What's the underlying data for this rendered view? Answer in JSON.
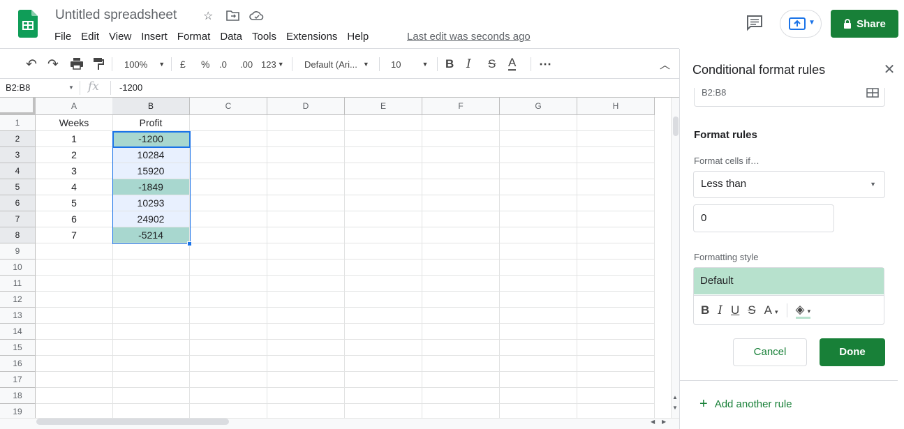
{
  "header": {
    "title": "Untitled spreadsheet",
    "last_edit": "Last edit was seconds ago",
    "share_label": "Share",
    "menu": [
      "File",
      "Edit",
      "View",
      "Insert",
      "Format",
      "Data",
      "Tools",
      "Extensions",
      "Help"
    ]
  },
  "toolbar": {
    "zoom": "100%",
    "currency": "£",
    "percent": "%",
    "dec_decrease": ".0",
    "dec_increase": ".00",
    "more_formats": "123",
    "font": "Default (Ari...",
    "font_size": "10",
    "bold": "B",
    "italic": "I",
    "strike": "S",
    "text_color": "A",
    "more": "⋯"
  },
  "formula_bar": {
    "namebox": "B2:B8",
    "fx": "fx",
    "value": "-1200"
  },
  "sheet": {
    "columns": [
      "A",
      "B",
      "C",
      "D",
      "E",
      "F",
      "G",
      "H"
    ],
    "rows": [
      "1",
      "2",
      "3",
      "4",
      "5",
      "6",
      "7",
      "8",
      "9",
      "10",
      "11",
      "12",
      "13",
      "14",
      "15",
      "16",
      "17",
      "18",
      "19"
    ],
    "col_a": [
      "Weeks",
      "1",
      "2",
      "3",
      "4",
      "5",
      "6",
      "7"
    ],
    "col_b": [
      "Profit",
      "-1200",
      "10284",
      "15920",
      "-1849",
      "10293",
      "24902",
      "-5214"
    ]
  },
  "panel": {
    "title": "Conditional format rules",
    "range": "B2:B8",
    "format_rules_label": "Format rules",
    "format_cells_if_label": "Format cells if…",
    "condition": "Less than",
    "value": "0",
    "formatting_style_label": "Formatting style",
    "style_preview": "Default",
    "cancel": "Cancel",
    "done": "Done",
    "add_rule": "Add another rule"
  },
  "colors": {
    "brand_green": "#188038",
    "highlight_fill": "#a8d7cf",
    "selection_fill": "#e8f0fe",
    "style_preview_fill": "#b7e1cd",
    "selection_blue": "#1a73e8"
  }
}
